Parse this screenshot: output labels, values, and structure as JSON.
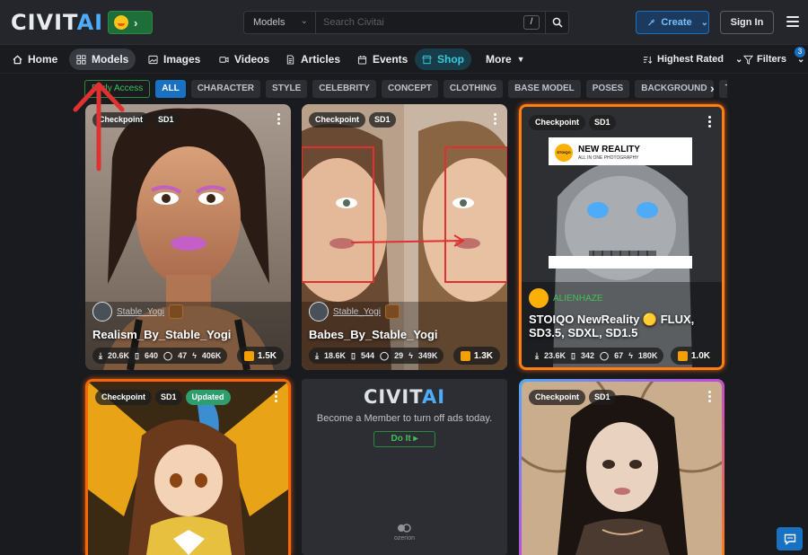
{
  "header": {
    "logo_main": "CIVIT",
    "logo_ai": "AI",
    "search_type": "Models",
    "search_placeholder": "Search Civitai",
    "search_shortcut": "/",
    "create_label": "Create",
    "signin_label": "Sign In"
  },
  "nav": {
    "items": [
      {
        "label": "Home",
        "icon": "home-icon"
      },
      {
        "label": "Models",
        "icon": "grid-icon"
      },
      {
        "label": "Images",
        "icon": "image-icon"
      },
      {
        "label": "Videos",
        "icon": "video-icon"
      },
      {
        "label": "Articles",
        "icon": "article-icon"
      },
      {
        "label": "Events",
        "icon": "calendar-icon"
      },
      {
        "label": "Shop",
        "icon": "shop-icon"
      },
      {
        "label": "More",
        "icon": "chevron-down-icon"
      }
    ],
    "sort_label": "Highest Rated",
    "filters_label": "Filters",
    "filters_count": "3"
  },
  "chips": [
    "Early Access",
    "ALL",
    "CHARACTER",
    "STYLE",
    "CELEBRITY",
    "CONCEPT",
    "CLOTHING",
    "BASE MODEL",
    "POSES",
    "BACKGROUND",
    "TOOL"
  ],
  "cards": [
    {
      "type": "Checkpoint",
      "base": "SD1",
      "updated": "",
      "user": "Stable_Yogi",
      "title": "Realism_By_Stable_Yogi",
      "downloads": "20.6K",
      "comments_a": "640",
      "comments_b": "47",
      "buzz": "406K",
      "likes": "1.5K"
    },
    {
      "type": "Checkpoint",
      "base": "SD1",
      "updated": "",
      "user": "Stable_Yogi",
      "title": "Babes_By_Stable_Yogi",
      "downloads": "18.6K",
      "comments_a": "544",
      "comments_b": "29",
      "buzz": "349K",
      "likes": "1.3K"
    },
    {
      "type": "Checkpoint",
      "base": "SD1",
      "updated": "",
      "user": "ALIENHAZE",
      "title": "STOIQO NewReality 🟡 FLUX, SD3.5, SDXL, SD1.5",
      "downloads": "23.6K",
      "comments_a": "342",
      "comments_b": "67",
      "buzz": "180K",
      "likes": "1.0K",
      "promo_title": "NEW REALITY",
      "promo_sub": "ALL IN ONE PHOTOGRAPHY",
      "promo_logo": "STOIQO"
    },
    {
      "type": "Checkpoint",
      "base": "SD1",
      "updated": "Updated"
    },
    {
      "type": "Checkpoint",
      "base": "SD1",
      "updated": ""
    }
  ],
  "ad": {
    "logo_main": "CIVIT",
    "logo_ai": "AI",
    "text": "Become a Member to turn off ads today.",
    "button": "Do It",
    "brand": "ozerion"
  },
  "colors": {
    "accent": "#1971c2",
    "success": "#40c057",
    "shop": "#3bc9db"
  }
}
